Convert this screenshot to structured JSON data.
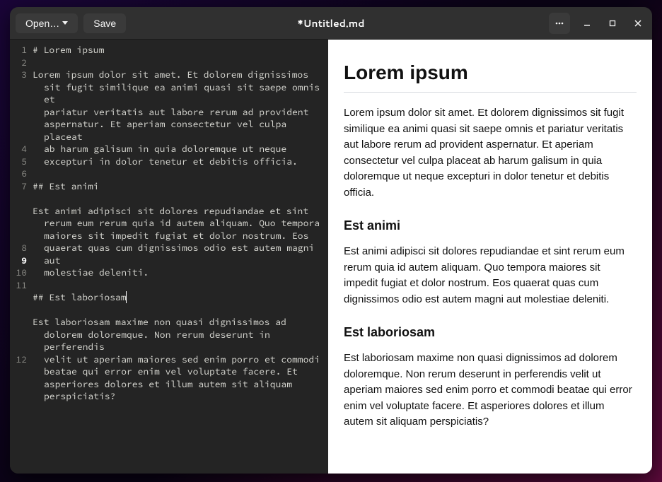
{
  "titlebar": {
    "open_label": "Open…",
    "save_label": "Save",
    "title": "*Untitled.md"
  },
  "editor": {
    "cursor_line": 9,
    "lines": [
      {
        "n": 1,
        "text": "# Lorem ipsum"
      },
      {
        "n": 2,
        "text": ""
      },
      {
        "n": 3,
        "text": "Lorem ipsum dolor sit amet. Et dolorem dignissimos sit fugit similique ea animi quasi sit saepe omnis et pariatur veritatis aut labore rerum ad provident aspernatur. Et aperiam consectetur vel culpa placeat ab harum galisum in quia doloremque ut neque excepturi in dolor tenetur et debitis officia."
      },
      {
        "n": 4,
        "text": ""
      },
      {
        "n": 5,
        "text": "## Est animi"
      },
      {
        "n": 6,
        "text": ""
      },
      {
        "n": 7,
        "text": "Est animi adipisci sit dolores repudiandae et sint rerum eum rerum quia id autem aliquam. Quo tempora maiores sit impedit fugiat et dolor nostrum. Eos quaerat quas cum dignissimos odio est autem magni aut molestiae deleniti."
      },
      {
        "n": 8,
        "text": ""
      },
      {
        "n": 9,
        "text": "## Est laboriosam"
      },
      {
        "n": 10,
        "text": ""
      },
      {
        "n": 11,
        "text": "Est laboriosam maxime non quasi dignissimos ad dolorem doloremque. Non rerum deserunt in perferendis velit ut aperiam maiores sed enim porro et commodi beatae qui error enim vel voluptate facere. Et asperiores dolores et illum autem sit aliquam perspiciatis?"
      },
      {
        "n": 12,
        "text": ""
      }
    ]
  },
  "preview": {
    "h1": "Lorem ipsum",
    "p1": "Lorem ipsum dolor sit amet. Et dolorem dignissimos sit fugit similique ea animi quasi sit saepe omnis et pariatur veritatis aut labore rerum ad provident aspernatur. Et aperiam consectetur vel culpa placeat ab harum galisum in quia doloremque ut neque excepturi in dolor tenetur et debitis officia.",
    "h2_1": "Est animi",
    "p2": "Est animi adipisci sit dolores repudiandae et sint rerum eum rerum quia id autem aliquam. Quo tempora maiores sit impedit fugiat et dolor nostrum. Eos quaerat quas cum dignissimos odio est autem magni aut molestiae deleniti.",
    "h2_2": "Est laboriosam",
    "p3": "Est laboriosam maxime non quasi dignissimos ad dolorem doloremque. Non rerum deserunt in perferendis velit ut aperiam maiores sed enim porro et commodi beatae qui error enim vel voluptate facere. Et asperiores dolores et illum autem sit aliquam perspiciatis?"
  }
}
